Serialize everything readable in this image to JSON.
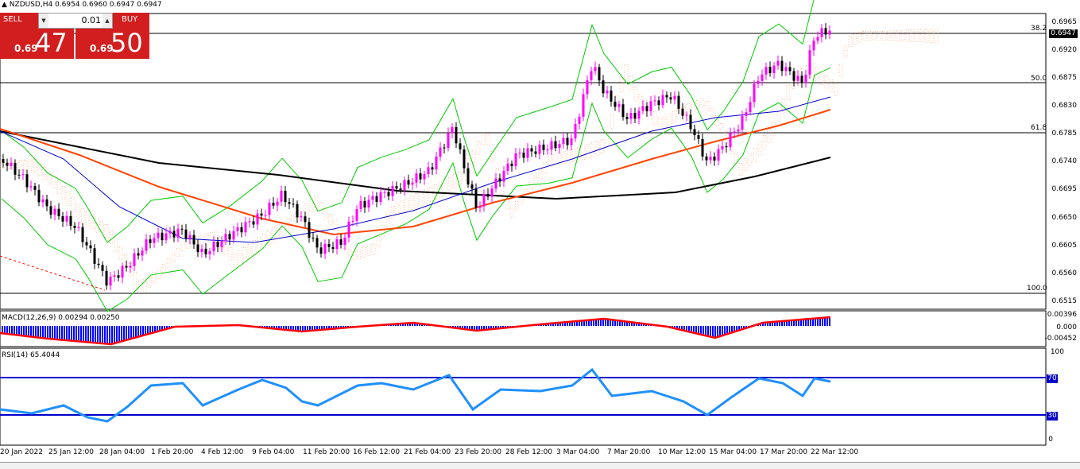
{
  "header": {
    "symbol_line": "NZDUSD,H4  0.6954 0.6960 0.6947 0.6947",
    "sell_label": "SELL",
    "buy_label": "BUY",
    "lot_value": "0.01",
    "sell_price_small": "0.69",
    "sell_price_big": "47",
    "buy_price_small": "0.69",
    "buy_price_big": "50"
  },
  "price_axis": [
    "0.6965",
    "0.6920",
    "0.6875",
    "0.6830",
    "0.6785",
    "0.6740",
    "0.6695",
    "0.6650",
    "0.6605",
    "0.6560",
    "0.6515"
  ],
  "current_price": "0.6947",
  "fibo_labels": [
    "38.2",
    "50.0",
    "61.8",
    "100.0"
  ],
  "macd": {
    "label": "MACD(12,26,9) 0.00294 0.00250",
    "axis": [
      "0.00396",
      "0.000",
      "-0.00452"
    ]
  },
  "rsi": {
    "label": "RSI(14) 65.4044",
    "axis": [
      "100",
      "70",
      "30",
      "0"
    ],
    "level_tags": [
      "70",
      "30"
    ]
  },
  "time_axis": [
    "20 Jan 2022",
    "25 Jan 12:00",
    "28 Jan 04:00",
    "1 Feb 20:00",
    "4 Feb 12:00",
    "9 Feb 04:00",
    "11 Feb 20:00",
    "16 Feb 12:00",
    "21 Feb 04:00",
    "23 Feb 20:00",
    "28 Feb 12:00",
    "3 Mar 04:00",
    "7 Mar 20:00",
    "10 Mar 12:00",
    "15 Mar 04:00",
    "17 Mar 20:00",
    "22 Mar 12:00"
  ],
  "colors": {
    "sell": "#d21e1e",
    "buy": "#d21e1e",
    "bull": "#ff00ff",
    "bear": "#000000",
    "bollinger": "#00cc00",
    "ema_fast": "#0000cc",
    "ema_slow": "#ff4400",
    "sma_long": "#000000",
    "ichimoku": "#ff8040",
    "macd_hist": "#0000ff",
    "macd_signal": "#ff0000",
    "rsi": "#1e90ff",
    "rsi_levels": "#0000cc"
  }
}
